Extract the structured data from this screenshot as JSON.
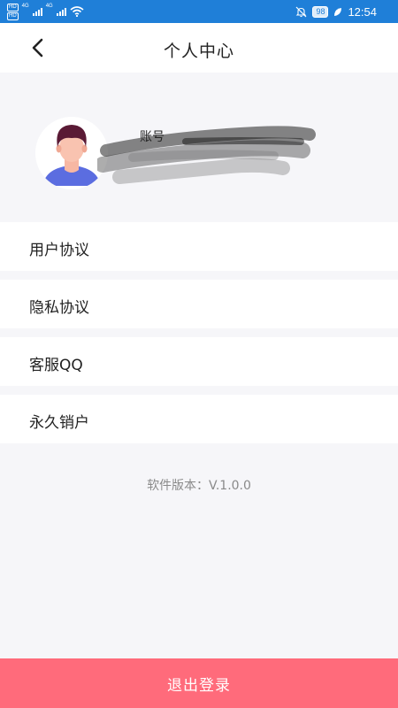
{
  "status_bar": {
    "left_badges": [
      "HD",
      "HD"
    ],
    "network_labels": [
      "4G",
      "4G"
    ],
    "battery": "98",
    "time": "12:54",
    "icons": [
      "hd-icon",
      "signal-icon",
      "wifi-icon",
      "mute-icon",
      "battery-icon",
      "leaf-icon"
    ]
  },
  "header": {
    "title": "个人中心",
    "back_icon": "chevron-left-icon"
  },
  "profile": {
    "account_label": "账号",
    "avatar_icon": "user-avatar"
  },
  "menu": {
    "items": [
      {
        "label": "用户协议"
      },
      {
        "label": "隐私协议"
      },
      {
        "label": "客服QQ"
      },
      {
        "label": "永久销户"
      }
    ]
  },
  "version": "软件版本：V.1.0.0",
  "logout_label": "退出登录",
  "colors": {
    "status_bar": "#1f7fd8",
    "logout_button": "#ff6b7b",
    "page_background": "#f6f6f9",
    "version_text": "#8a8a8a"
  }
}
